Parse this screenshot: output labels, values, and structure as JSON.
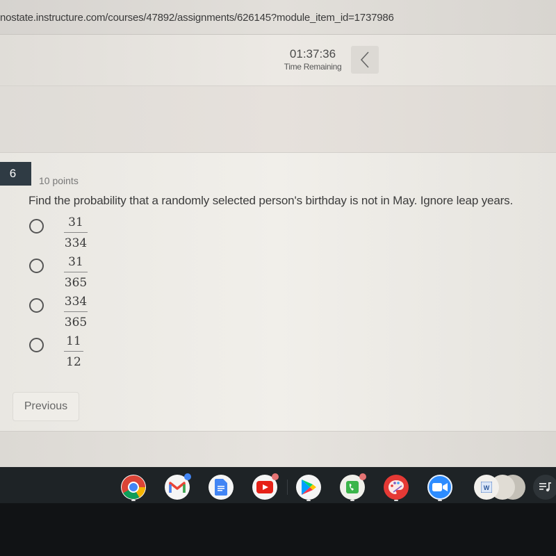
{
  "browser": {
    "url": "nostate.instructure.com/courses/47892/assignments/626145?module_item_id=1737986"
  },
  "quiz_header": {
    "timer_value": "01:37:36",
    "timer_label": "Time Remaining",
    "collapse_icon": "chevron-left-icon"
  },
  "question": {
    "number": "6",
    "points": "10 points",
    "text": "Find the probability that a randomly selected person's birthday is not in May. Ignore leap years.",
    "answers": [
      {
        "numerator": "31",
        "denominator": "334",
        "selected": false
      },
      {
        "numerator": "31",
        "denominator": "365",
        "selected": false
      },
      {
        "numerator": "334",
        "denominator": "365",
        "selected": false
      },
      {
        "numerator": "11",
        "denominator": "12",
        "selected": false
      }
    ]
  },
  "navigation": {
    "previous_label": "Previous"
  },
  "shelf": {
    "apps": [
      {
        "name": "Chrome",
        "icon": "chrome-icon",
        "running": true
      },
      {
        "name": "Gmail",
        "icon": "gmail-icon",
        "badge": true,
        "badge_color": "#4285f4"
      },
      {
        "name": "Google Docs",
        "icon": "docs-icon"
      },
      {
        "name": "YouTube",
        "icon": "youtube-icon",
        "badge": true,
        "badge_color": "#e57373"
      },
      {
        "name": "Play Store",
        "icon": "play-store-icon",
        "running": true
      },
      {
        "name": "Phone",
        "icon": "phone-icon",
        "badge": true,
        "badge_color": "#e57373",
        "running": true
      },
      {
        "name": "Paint",
        "icon": "palette-icon",
        "running": true
      },
      {
        "name": "Zoom",
        "icon": "zoom-icon",
        "running": true
      },
      {
        "name": "Word",
        "icon": "word-icon",
        "running": true
      },
      {
        "name": "Media",
        "icon": "playlist-icon"
      }
    ]
  },
  "colors": {
    "question_number_bg": "#2f3b44",
    "shelf_bg": "#1e2326"
  }
}
